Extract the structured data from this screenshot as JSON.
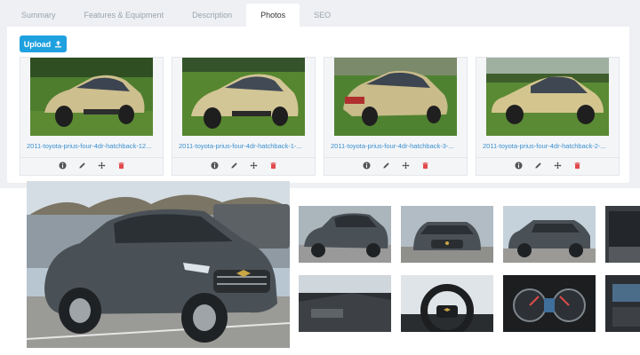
{
  "tabs": [
    {
      "label": "Summary",
      "active": false
    },
    {
      "label": "Features & Equipment",
      "active": false
    },
    {
      "label": "Description",
      "active": false
    },
    {
      "label": "Photos",
      "active": true
    },
    {
      "label": "SEO",
      "active": false
    }
  ],
  "upload": {
    "label": "Upload",
    "icon": "upload-icon"
  },
  "photos": [
    {
      "filename": "2011-toyota-prius-four-4dr-hatchback-12...",
      "view": "front-left"
    },
    {
      "filename": "2011-toyota-prius-four-4dr-hatchback-1-...",
      "view": "front-left"
    },
    {
      "filename": "2011-toyota-prius-four-4dr-hatchback-3-...",
      "view": "rear-left"
    },
    {
      "filename": "2011-toyota-prius-four-4dr-hatchback-2-...",
      "view": "side"
    }
  ],
  "photo_actions": [
    "info-icon",
    "pencil-icon",
    "move-icon",
    "trash-icon"
  ],
  "colors": {
    "accent": "#1fa0df",
    "link": "#3a8fd0",
    "delete": "#e04b4b",
    "prius": "#cdbf8e",
    "equinox": "#4a5156"
  },
  "gallery": {
    "hero": "chevrolet-equinox-front",
    "thumbs": [
      "equinox-front-left",
      "equinox-front",
      "equinox-side",
      "equinox-cargo",
      "equinox-interior-door",
      "equinox-steering-wheel",
      "equinox-gauge-cluster",
      "equinox-dashboard"
    ]
  }
}
